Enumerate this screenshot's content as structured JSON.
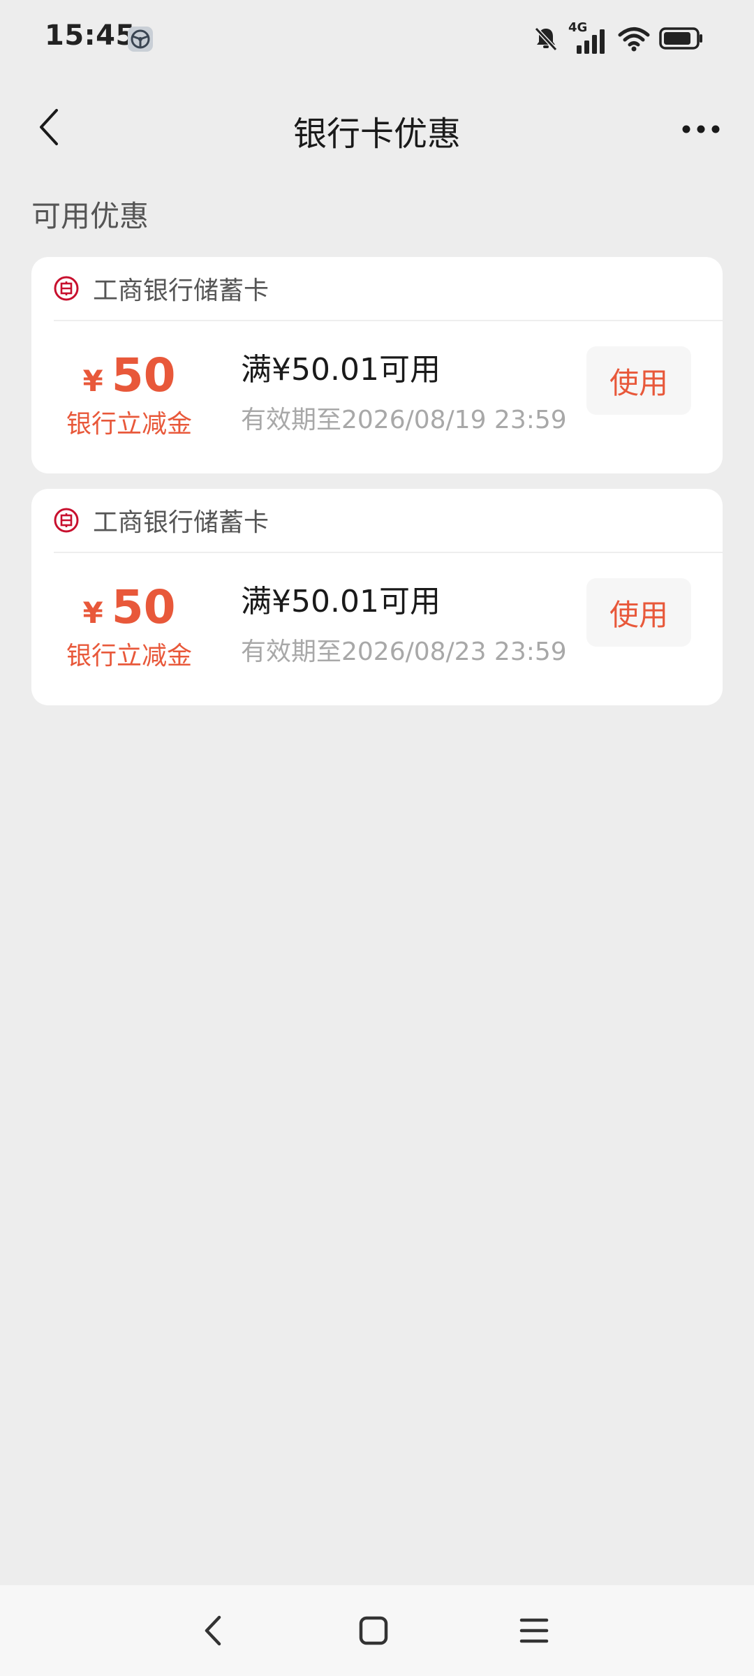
{
  "status_bar": {
    "time": "15:45",
    "network": "4G"
  },
  "header": {
    "title": "银行卡优惠"
  },
  "section": {
    "title": "可用优惠"
  },
  "coupons": [
    {
      "bank": "工商银行储蓄卡",
      "currency": "¥",
      "amount": "50",
      "label": "银行立减金",
      "condition": "满¥50.01可用",
      "validity": "有效期至2026/08/19 23:59",
      "action": "使用"
    },
    {
      "bank": "工商银行储蓄卡",
      "currency": "¥",
      "amount": "50",
      "label": "银行立减金",
      "condition": "满¥50.01可用",
      "validity": "有效期至2026/08/23 23:59",
      "action": "使用"
    }
  ],
  "colors": {
    "accent": "#E8583A",
    "bank_logo": "#C8102E",
    "background": "#EDEDED"
  },
  "icons": {
    "back": "chevron-left-icon",
    "more": "more-horizontal-icon",
    "bank": "icbc-logo-icon",
    "nav_back": "nav-back-icon",
    "nav_home": "nav-home-icon",
    "nav_menu": "nav-menu-icon"
  }
}
